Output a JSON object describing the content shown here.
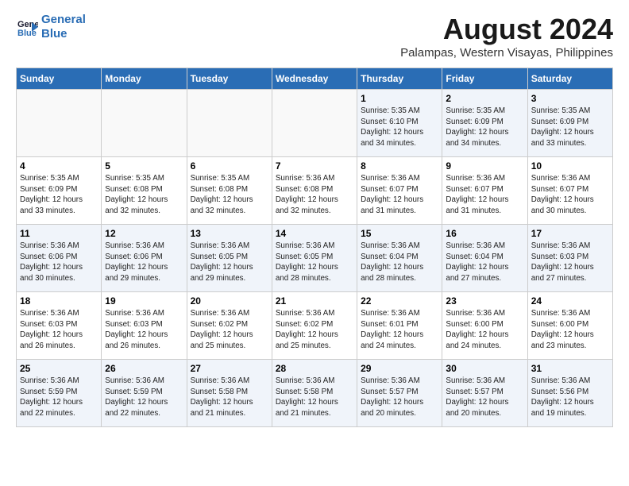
{
  "logo": {
    "line1": "General",
    "line2": "Blue"
  },
  "title": "August 2024",
  "subtitle": "Palampas, Western Visayas, Philippines",
  "header": {
    "accent_color": "#2a6db5"
  },
  "days_of_week": [
    "Sunday",
    "Monday",
    "Tuesday",
    "Wednesday",
    "Thursday",
    "Friday",
    "Saturday"
  ],
  "weeks": [
    [
      {
        "day": "",
        "info": ""
      },
      {
        "day": "",
        "info": ""
      },
      {
        "day": "",
        "info": ""
      },
      {
        "day": "",
        "info": ""
      },
      {
        "day": "1",
        "info": "Sunrise: 5:35 AM\nSunset: 6:10 PM\nDaylight: 12 hours\nand 34 minutes."
      },
      {
        "day": "2",
        "info": "Sunrise: 5:35 AM\nSunset: 6:09 PM\nDaylight: 12 hours\nand 34 minutes."
      },
      {
        "day": "3",
        "info": "Sunrise: 5:35 AM\nSunset: 6:09 PM\nDaylight: 12 hours\nand 33 minutes."
      }
    ],
    [
      {
        "day": "4",
        "info": "Sunrise: 5:35 AM\nSunset: 6:09 PM\nDaylight: 12 hours\nand 33 minutes."
      },
      {
        "day": "5",
        "info": "Sunrise: 5:35 AM\nSunset: 6:08 PM\nDaylight: 12 hours\nand 32 minutes."
      },
      {
        "day": "6",
        "info": "Sunrise: 5:35 AM\nSunset: 6:08 PM\nDaylight: 12 hours\nand 32 minutes."
      },
      {
        "day": "7",
        "info": "Sunrise: 5:36 AM\nSunset: 6:08 PM\nDaylight: 12 hours\nand 32 minutes."
      },
      {
        "day": "8",
        "info": "Sunrise: 5:36 AM\nSunset: 6:07 PM\nDaylight: 12 hours\nand 31 minutes."
      },
      {
        "day": "9",
        "info": "Sunrise: 5:36 AM\nSunset: 6:07 PM\nDaylight: 12 hours\nand 31 minutes."
      },
      {
        "day": "10",
        "info": "Sunrise: 5:36 AM\nSunset: 6:07 PM\nDaylight: 12 hours\nand 30 minutes."
      }
    ],
    [
      {
        "day": "11",
        "info": "Sunrise: 5:36 AM\nSunset: 6:06 PM\nDaylight: 12 hours\nand 30 minutes."
      },
      {
        "day": "12",
        "info": "Sunrise: 5:36 AM\nSunset: 6:06 PM\nDaylight: 12 hours\nand 29 minutes."
      },
      {
        "day": "13",
        "info": "Sunrise: 5:36 AM\nSunset: 6:05 PM\nDaylight: 12 hours\nand 29 minutes."
      },
      {
        "day": "14",
        "info": "Sunrise: 5:36 AM\nSunset: 6:05 PM\nDaylight: 12 hours\nand 28 minutes."
      },
      {
        "day": "15",
        "info": "Sunrise: 5:36 AM\nSunset: 6:04 PM\nDaylight: 12 hours\nand 28 minutes."
      },
      {
        "day": "16",
        "info": "Sunrise: 5:36 AM\nSunset: 6:04 PM\nDaylight: 12 hours\nand 27 minutes."
      },
      {
        "day": "17",
        "info": "Sunrise: 5:36 AM\nSunset: 6:03 PM\nDaylight: 12 hours\nand 27 minutes."
      }
    ],
    [
      {
        "day": "18",
        "info": "Sunrise: 5:36 AM\nSunset: 6:03 PM\nDaylight: 12 hours\nand 26 minutes."
      },
      {
        "day": "19",
        "info": "Sunrise: 5:36 AM\nSunset: 6:03 PM\nDaylight: 12 hours\nand 26 minutes."
      },
      {
        "day": "20",
        "info": "Sunrise: 5:36 AM\nSunset: 6:02 PM\nDaylight: 12 hours\nand 25 minutes."
      },
      {
        "day": "21",
        "info": "Sunrise: 5:36 AM\nSunset: 6:02 PM\nDaylight: 12 hours\nand 25 minutes."
      },
      {
        "day": "22",
        "info": "Sunrise: 5:36 AM\nSunset: 6:01 PM\nDaylight: 12 hours\nand 24 minutes."
      },
      {
        "day": "23",
        "info": "Sunrise: 5:36 AM\nSunset: 6:00 PM\nDaylight: 12 hours\nand 24 minutes."
      },
      {
        "day": "24",
        "info": "Sunrise: 5:36 AM\nSunset: 6:00 PM\nDaylight: 12 hours\nand 23 minutes."
      }
    ],
    [
      {
        "day": "25",
        "info": "Sunrise: 5:36 AM\nSunset: 5:59 PM\nDaylight: 12 hours\nand 22 minutes."
      },
      {
        "day": "26",
        "info": "Sunrise: 5:36 AM\nSunset: 5:59 PM\nDaylight: 12 hours\nand 22 minutes."
      },
      {
        "day": "27",
        "info": "Sunrise: 5:36 AM\nSunset: 5:58 PM\nDaylight: 12 hours\nand 21 minutes."
      },
      {
        "day": "28",
        "info": "Sunrise: 5:36 AM\nSunset: 5:58 PM\nDaylight: 12 hours\nand 21 minutes."
      },
      {
        "day": "29",
        "info": "Sunrise: 5:36 AM\nSunset: 5:57 PM\nDaylight: 12 hours\nand 20 minutes."
      },
      {
        "day": "30",
        "info": "Sunrise: 5:36 AM\nSunset: 5:57 PM\nDaylight: 12 hours\nand 20 minutes."
      },
      {
        "day": "31",
        "info": "Sunrise: 5:36 AM\nSunset: 5:56 PM\nDaylight: 12 hours\nand 19 minutes."
      }
    ]
  ]
}
